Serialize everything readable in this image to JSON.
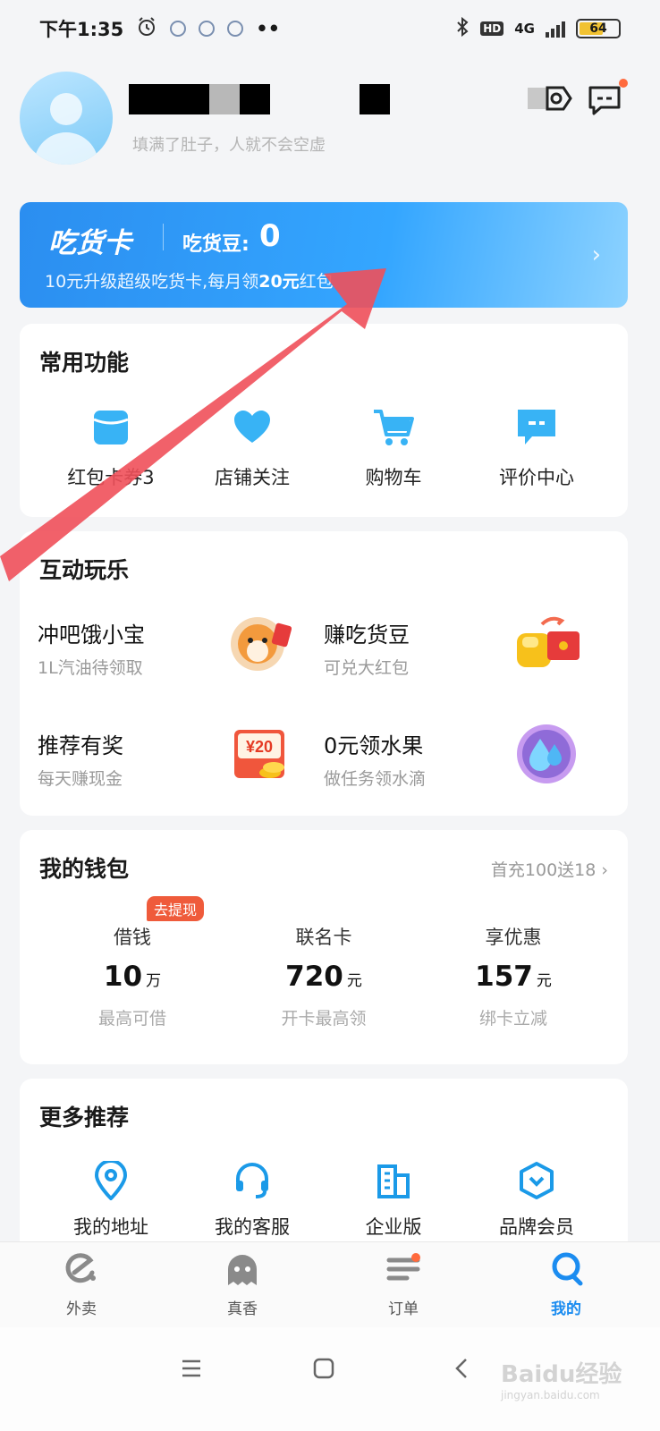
{
  "status_bar": {
    "time": "下午1:35",
    "network": "4G",
    "hd": "HD",
    "battery": "64",
    "battery_level": 0.64
  },
  "profile": {
    "slogan": "填满了肚子，人就不会空虚"
  },
  "vip_card": {
    "title": "吃货卡",
    "beans_label": "吃货豆:",
    "beans_value": "0",
    "desc_prefix": "10元升级超级吃货卡,每月领",
    "desc_highlight": "20元",
    "desc_suffix": "红包"
  },
  "common_functions": {
    "title": "常用功能",
    "items": [
      {
        "label": "红包卡券3",
        "icon": "red-packet-icon"
      },
      {
        "label": "店铺关注",
        "icon": "heart-icon"
      },
      {
        "label": "购物车",
        "icon": "cart-icon"
      },
      {
        "label": "评价中心",
        "icon": "review-icon"
      }
    ]
  },
  "interactive": {
    "title": "互动玩乐",
    "items": [
      {
        "title": "冲吧饿小宝",
        "subtitle": "1L汽油待领取",
        "icon": "mascot-icon"
      },
      {
        "title": "赚吃货豆",
        "subtitle": "可兑大红包",
        "icon": "beans-icon"
      },
      {
        "title": "推荐有奖",
        "subtitle": "每天赚现金",
        "icon": "coupon-icon",
        "coupon_text": "¥20"
      },
      {
        "title": "0元领水果",
        "subtitle": "做任务领水滴",
        "icon": "water-drop-icon"
      }
    ]
  },
  "wallet": {
    "title": "我的钱包",
    "promo": "首充100送18",
    "badge": "去提现",
    "columns": [
      {
        "label": "借钱",
        "value": "10",
        "unit": "万",
        "sub": "最高可借"
      },
      {
        "label": "联名卡",
        "value": "720",
        "unit": "元",
        "sub": "开卡最高领"
      },
      {
        "label": "享优惠",
        "value": "157",
        "unit": "元",
        "sub": "绑卡立减"
      }
    ]
  },
  "more": {
    "title": "更多推荐",
    "items": [
      {
        "label": "我的地址",
        "icon": "location-icon"
      },
      {
        "label": "我的客服",
        "icon": "headset-icon"
      },
      {
        "label": "企业版",
        "icon": "building-icon"
      },
      {
        "label": "品牌会员",
        "icon": "member-shield-icon"
      }
    ]
  },
  "tabbar": {
    "tabs": [
      {
        "label": "外卖",
        "icon": "eleme-icon"
      },
      {
        "label": "真香",
        "icon": "ghost-icon"
      },
      {
        "label": "订单",
        "icon": "order-list-icon"
      },
      {
        "label": "我的",
        "icon": "profile-icon",
        "active": true
      }
    ]
  },
  "colors": {
    "accent": "#1b8cf0",
    "vip_gradient_start": "#2b8ef0",
    "badge": "#ef5b3b",
    "arrow": "#f0505a"
  },
  "watermark": {
    "brand": "Baidu经验",
    "url": "jingyan.baidu.com"
  }
}
